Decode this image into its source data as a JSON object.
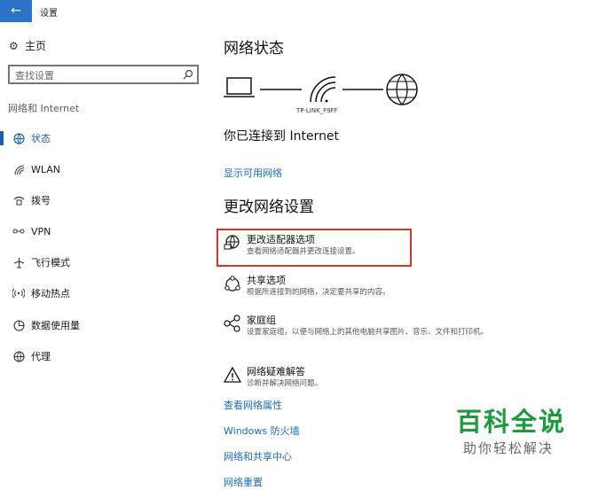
{
  "window": {
    "title": "设置",
    "back_glyph": "←"
  },
  "sidebar": {
    "home_label": "主页",
    "search_placeholder": "查找设置",
    "section_label": "网络和 Internet",
    "items": [
      {
        "label": "状态",
        "icon": "status-icon",
        "active": true
      },
      {
        "label": "WLAN",
        "icon": "wifi-icon",
        "active": false
      },
      {
        "label": "拨号",
        "icon": "dialup-icon",
        "active": false
      },
      {
        "label": "VPN",
        "icon": "vpn-icon",
        "active": false
      },
      {
        "label": "飞行模式",
        "icon": "airplane-icon",
        "active": false
      },
      {
        "label": "移动热点",
        "icon": "hotspot-icon",
        "active": false
      },
      {
        "label": "数据使用量",
        "icon": "data-usage-icon",
        "active": false
      },
      {
        "label": "代理",
        "icon": "globe-icon",
        "active": false
      }
    ]
  },
  "main": {
    "title": "网络状态",
    "network_name": "TP-LINK_F9FF",
    "connected_text": "你已连接到 Internet",
    "show_networks_link": "显示可用网络",
    "change_title": "更改网络设置",
    "options": [
      {
        "title": "更改适配器选项",
        "desc": "查看网络适配器并更改连接设置。",
        "icon": "adapter-icon"
      },
      {
        "title": "共享选项",
        "desc": "根据所连接到的网络，决定要共享的内容。",
        "icon": "sharing-icon"
      },
      {
        "title": "家庭组",
        "desc": "设置家庭组，以便与网络上的其他电脑共享图片、音乐、文件和打印机。",
        "icon": "homegroup-icon"
      },
      {
        "title": "网络疑难解答",
        "desc": "诊断并解决网络问题。",
        "icon": "warning-icon"
      }
    ],
    "links": [
      "查看网络属性",
      "Windows 防火墙",
      "网络和共享中心",
      "网络重置"
    ]
  },
  "watermark": {
    "title": "百科全说",
    "subtitle": "助你轻松解决"
  },
  "colors": {
    "accent": "#1a5fb4",
    "link": "#1a6ac0",
    "highlight": "#d9342b",
    "watermark": "#1a9b3c"
  }
}
